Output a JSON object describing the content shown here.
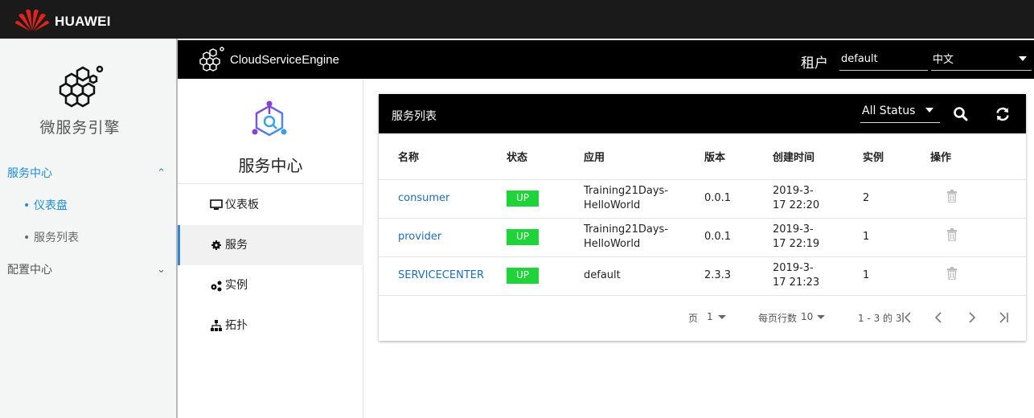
{
  "brand": {
    "name": "HUAWEI"
  },
  "leftnav": {
    "title": "微服务引擎",
    "groups": [
      {
        "label": "服务中心",
        "items": [
          {
            "label": "仪表盘"
          },
          {
            "label": "服务列表"
          }
        ]
      },
      {
        "label": "配置中心"
      }
    ]
  },
  "cse": {
    "app_name": "CloudServiceEngine",
    "tenant_label": "租户",
    "tenant_value": "default",
    "language": "中文"
  },
  "subnav": {
    "title": "服务中心",
    "items": [
      {
        "label": "仪表板",
        "icon": "monitor-icon"
      },
      {
        "label": "服务",
        "icon": "gear-icon"
      },
      {
        "label": "实例",
        "icon": "gears-icon"
      },
      {
        "label": "拓扑",
        "icon": "sitemap-icon"
      }
    ]
  },
  "panel": {
    "title": "服务列表",
    "status_filter": "All Status",
    "columns": [
      "名称",
      "状态",
      "应用",
      "版本",
      "创建时间",
      "实例",
      "操作"
    ],
    "rows": [
      {
        "name": "consumer",
        "status": "UP",
        "app_line1": "Training21Days-",
        "app_line2": "HelloWorld",
        "version": "0.0.1",
        "created_line1": "2019-3-",
        "created_line2": "17 22:20",
        "instances": "2"
      },
      {
        "name": "provider",
        "status": "UP",
        "app_line1": "Training21Days-",
        "app_line2": "HelloWorld",
        "version": "0.0.1",
        "created_line1": "2019-3-",
        "created_line2": "17 22:19",
        "instances": "1"
      },
      {
        "name": "SERVICECENTER",
        "status": "UP",
        "app_line1": "default",
        "app_line2": "",
        "version": "2.3.3",
        "created_line1": "2019-3-",
        "created_line2": "17 21:23",
        "instances": "1"
      }
    ]
  },
  "pager": {
    "page_label": "页",
    "page_value": "1",
    "per_page_label": "每页行数",
    "per_page_value": "10",
    "range": "1 - 3 的 3"
  },
  "colors": {
    "accent": "#1a8fd6",
    "status_up": "#1ed438",
    "link": "#1f6db3",
    "brand_red": "#e2231a"
  }
}
